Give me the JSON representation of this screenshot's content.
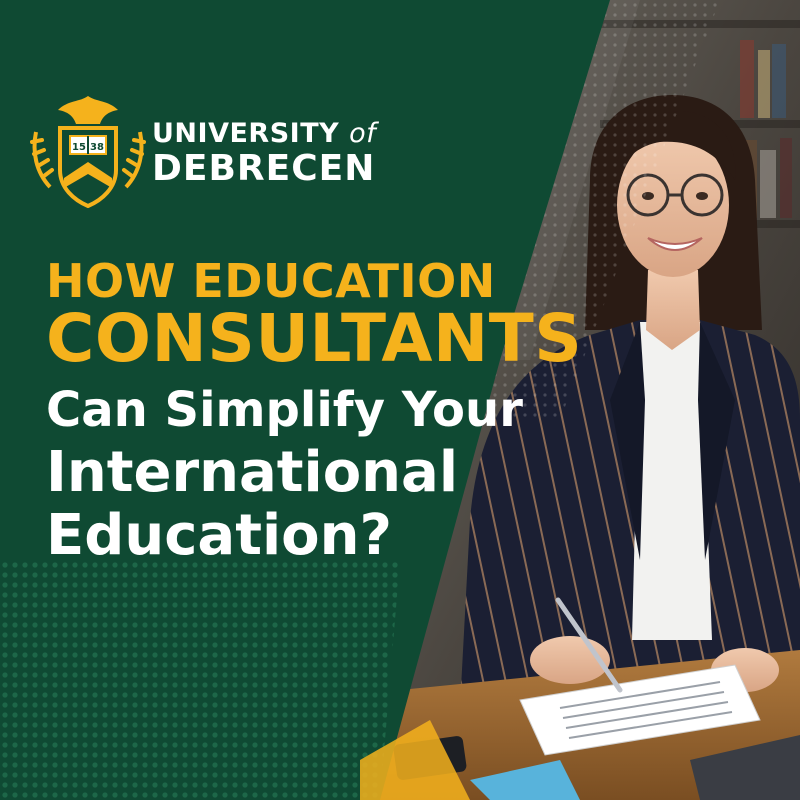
{
  "brand": {
    "name_line1": "UNIVERSITY",
    "name_of": "of",
    "name_line2": "DEBRECEN",
    "crest_year_left": "15",
    "crest_year_right": "38"
  },
  "headline": {
    "line1": "HOW EDUCATION",
    "line2": "CONSULTANTS",
    "line3": "Can Simplify Your",
    "line4": "International",
    "line5": "Education?"
  },
  "colors": {
    "panel_green": "#0f4a33",
    "accent_yellow": "#f5b21c",
    "text_white": "#ffffff"
  },
  "image": {
    "subject": "smiling woman with glasses in pinstripe blazer signing documents at a desk",
    "icons": [
      "university-crest-icon",
      "pen-icon",
      "smartphone-icon",
      "laptop-icon"
    ]
  }
}
